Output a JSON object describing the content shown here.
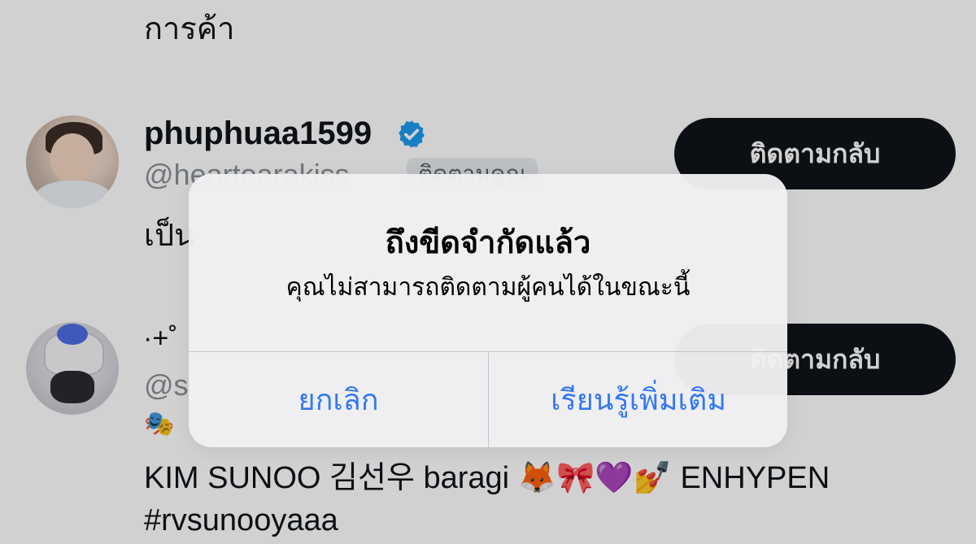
{
  "feed": {
    "top_text": "การค้า",
    "user1": {
      "display_name": "phuphuaa1599",
      "verified_icon": "verified-badge-icon",
      "handle": "@heartoarakiss",
      "follows_you_badge": "ติดตามคุณ",
      "bio": "เป็น",
      "follow_back_label": "ติดตามกลับ"
    },
    "user2": {
      "display_name": "·+˚",
      "handle": "@s",
      "bio_icon": "theater-masks-icon",
      "bio": "KIM SUNOO 김선우 baragi 🦊🎀💜💅 ENHYPEN",
      "bio_hashtag": "#rvsunooyaaa",
      "follow_back_label": "ติดตามกลับ"
    }
  },
  "alert": {
    "title": "ถึงขีดจำกัดแล้ว",
    "message": "คุณไม่สามารถติดตามผู้คนได้ในขณะนี้",
    "cancel_label": "ยกเลิก",
    "learn_more_label": "เรียนรู้เพิ่มเติม"
  },
  "colors": {
    "accent": "#3478f6",
    "verified": "#1d9bf0",
    "button_bg": "#0f1419",
    "alert_bg": "#efeff2"
  }
}
